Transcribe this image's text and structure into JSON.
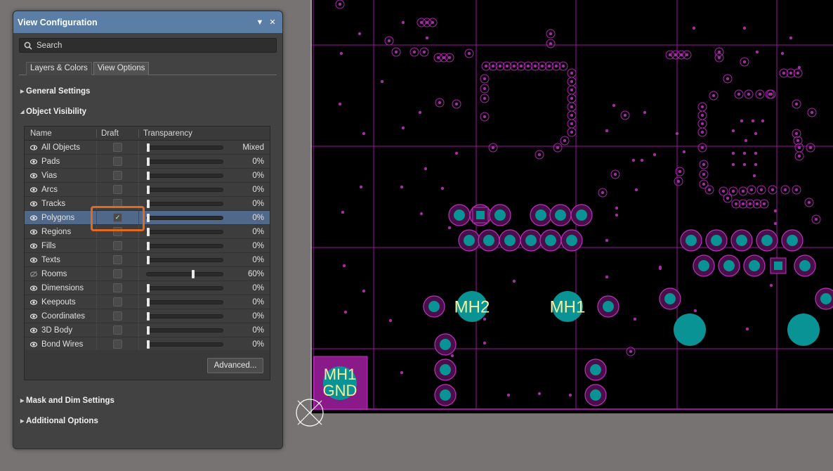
{
  "panel": {
    "title": "View Configuration",
    "search": {
      "placeholder": "Search",
      "value": ""
    },
    "tabs": [
      {
        "label": "Layers & Colors",
        "active": false
      },
      {
        "label": "View Options",
        "active": true
      }
    ],
    "sections": {
      "general_settings": "General Settings",
      "object_visibility": "Object Visibility",
      "mask_dim": "Mask and Dim Settings",
      "additional_options": "Additional Options"
    },
    "table": {
      "columns": [
        "Name",
        "Draft",
        "Transparency"
      ],
      "rows": [
        {
          "name": "All Objects",
          "visible": "mixed",
          "draft": false,
          "transparency": 0,
          "value_text": "Mixed"
        },
        {
          "name": "Pads",
          "visible": true,
          "draft": false,
          "transparency": 0,
          "value_text": "0%"
        },
        {
          "name": "Vias",
          "visible": true,
          "draft": false,
          "transparency": 0,
          "value_text": "0%"
        },
        {
          "name": "Arcs",
          "visible": true,
          "draft": false,
          "transparency": 0,
          "value_text": "0%"
        },
        {
          "name": "Tracks",
          "visible": true,
          "draft": false,
          "transparency": 0,
          "value_text": "0%"
        },
        {
          "name": "Polygons",
          "visible": true,
          "draft": true,
          "transparency": 0,
          "value_text": "0%",
          "selected": true
        },
        {
          "name": "Regions",
          "visible": true,
          "draft": false,
          "transparency": 0,
          "value_text": "0%"
        },
        {
          "name": "Fills",
          "visible": true,
          "draft": false,
          "transparency": 0,
          "value_text": "0%"
        },
        {
          "name": "Texts",
          "visible": true,
          "draft": false,
          "transparency": 0,
          "value_text": "0%"
        },
        {
          "name": "Rooms",
          "visible": false,
          "draft": false,
          "transparency": 60,
          "value_text": "60%"
        },
        {
          "name": "Dimensions",
          "visible": true,
          "draft": false,
          "transparency": 0,
          "value_text": "0%"
        },
        {
          "name": "Keepouts",
          "visible": true,
          "draft": false,
          "transparency": 0,
          "value_text": "0%"
        },
        {
          "name": "Coordinates",
          "visible": true,
          "draft": false,
          "transparency": 0,
          "value_text": "0%"
        },
        {
          "name": "3D Body",
          "visible": true,
          "draft": false,
          "transparency": 0,
          "value_text": "0%"
        },
        {
          "name": "Bond Wires",
          "visible": true,
          "draft": false,
          "transparency": 0,
          "value_text": "0%"
        }
      ]
    },
    "advanced_label": "Advanced..."
  },
  "pcb": {
    "labels": {
      "mh2": "MH2",
      "mh1": "MH1",
      "mh1_gnd_top": "MH1",
      "mh1_gnd_bottom": "GND"
    },
    "colors": {
      "background": "#000000",
      "grid": "#b010b0",
      "pad": "#0a9394",
      "via": "#7a1a7a",
      "text": "#f5f0a0"
    }
  },
  "colors": {
    "accent": "#5a7ea6",
    "highlight": "#e06a1f",
    "selected_row": "#50698a"
  }
}
